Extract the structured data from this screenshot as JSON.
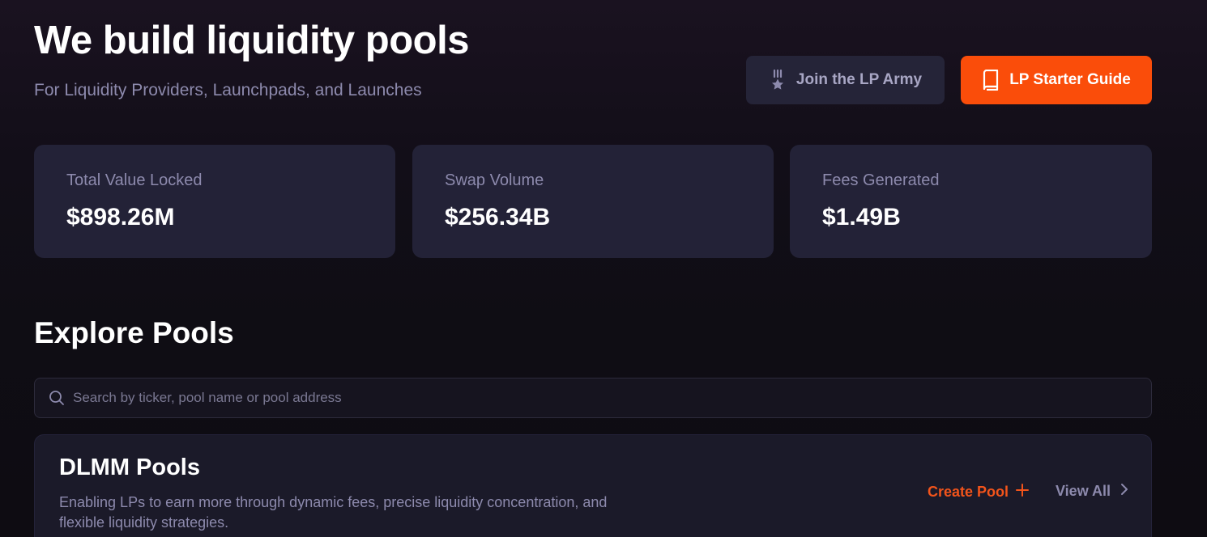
{
  "hero": {
    "title": "We build liquidity pools",
    "subtitle": "For Liquidity Providers, Launchpads, and Launches"
  },
  "actions": {
    "army_label": "Join the LP Army",
    "army_icon": "medal-star-icon",
    "guide_label": "LP Starter Guide",
    "guide_icon": "book-icon"
  },
  "stats": [
    {
      "label": "Total Value Locked",
      "value": "$898.26M"
    },
    {
      "label": "Swap Volume",
      "value": "$256.34B"
    },
    {
      "label": "Fees Generated",
      "value": "$1.49B"
    }
  ],
  "explore": {
    "title": "Explore Pools",
    "search_placeholder": "Search by ticker, pool name or pool address",
    "search_value": ""
  },
  "dlmm": {
    "title": "DLMM Pools",
    "description": "Enabling LPs to earn more through dynamic fees, precise liquidity concentration, and flexible liquidity strategies.",
    "create_label": "Create Pool",
    "view_all_label": "View All"
  },
  "colors": {
    "accent": "#fa4d0a",
    "card_bg": "#232237",
    "muted_text": "#8d8aad"
  }
}
